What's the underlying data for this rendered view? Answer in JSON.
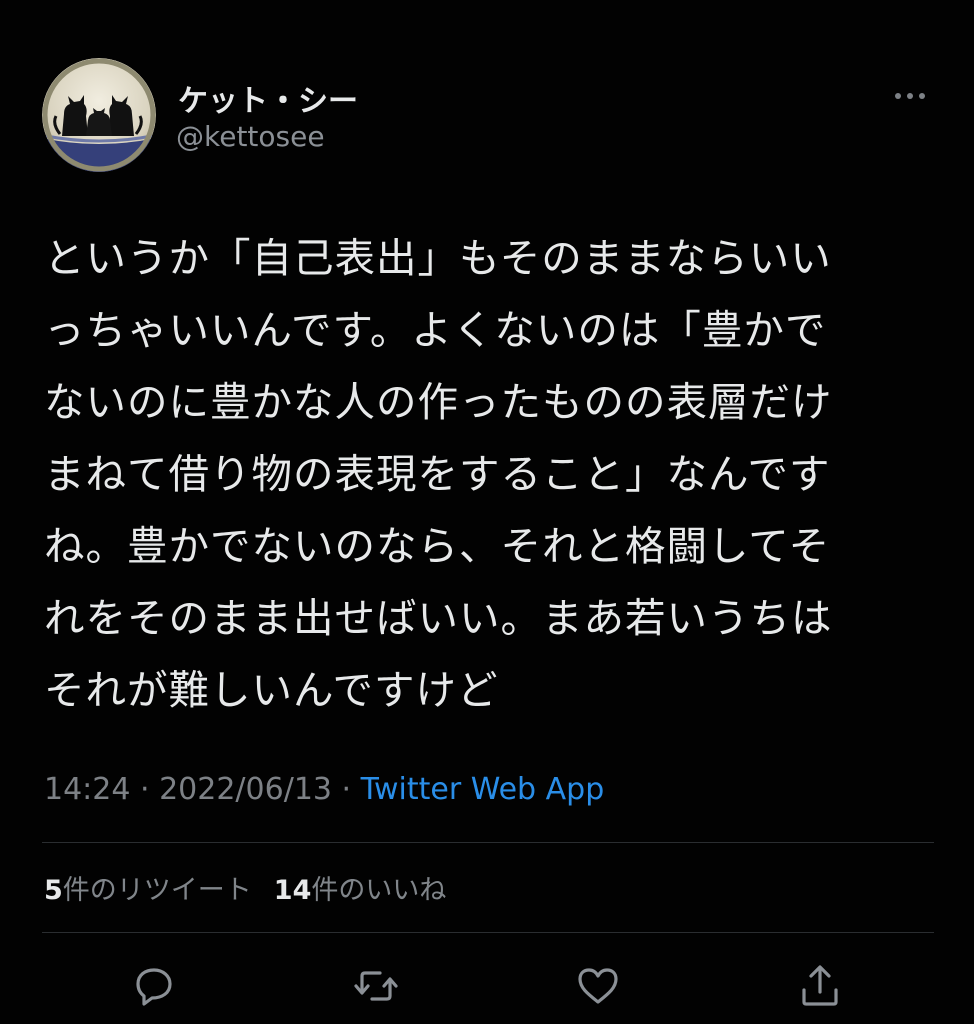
{
  "author": {
    "display_name": "ケット・シー",
    "handle": "@kettosee",
    "avatar_icon": "black-cats-avatar-icon"
  },
  "tweet": {
    "lines": [
      "というか「自己表出」もそのままならいい",
      "っちゃいいんです。よくないのは「豊かで",
      "ないのに豊かな人の作ったものの表層だけ",
      "まねて借り物の表現をすること」なんです",
      "ね。豊かでないのなら、それと格闘してそ",
      "れをそのまま出せばいい。まあ若いうちは",
      "それが難しいんですけど"
    ],
    "time": "14:24",
    "separator": " · ",
    "date": "2022/06/13",
    "source": "Twitter Web App"
  },
  "stats": {
    "retweets_count": "5",
    "retweets_label": "件のリツイート",
    "likes_count": "14",
    "likes_label": "件のいいね"
  },
  "actions": {
    "icons": [
      "reply-icon",
      "retweet-icon",
      "like-icon",
      "share-icon"
    ]
  },
  "colors": {
    "background": "#020202",
    "text": "#e7e9ea",
    "secondary_text": "#8b9096",
    "link": "#2a8ee8",
    "divider": "#2a2d30"
  }
}
